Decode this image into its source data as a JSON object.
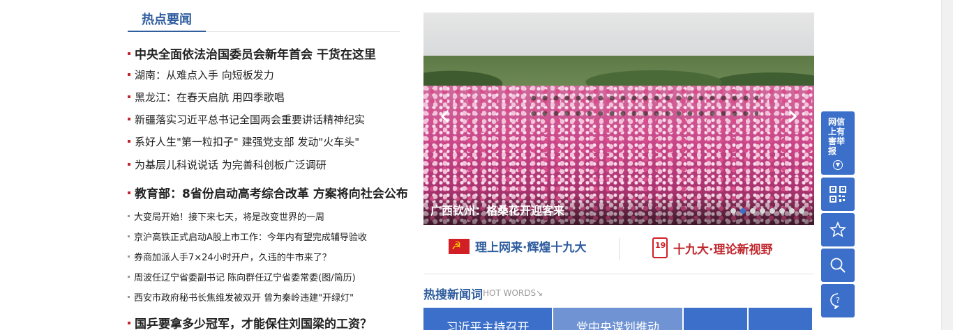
{
  "hot_news": {
    "title": "热点要闻",
    "items": [
      {
        "text": "中央全面依法治国委员会新年首会 干货在这里",
        "style": "big"
      },
      {
        "text": "湖南：从难点入手 向短板发力",
        "style": "normal"
      },
      {
        "text": "黑龙江：在春天启航 用四季歌唱",
        "style": "normal"
      },
      {
        "text": "新疆落实习近平总书记全国两会重要讲话精神纪实",
        "style": "normal"
      },
      {
        "text": "系好人生\"第一粒扣子\" 建强党支部 发动\"火车头\"",
        "style": "normal"
      },
      {
        "text": "为基层儿科说说话  为完善科创板广泛调研",
        "style": "normal"
      },
      {
        "text": "教育部：8省份启动高考综合改革 方案将向社会公布",
        "style": "big"
      },
      {
        "text": "大变局开始！接下来七天，将是改变世界的一周",
        "style": "small"
      },
      {
        "text": "京沪高铁正式启动A股上市工作：今年内有望完成辅导验收",
        "style": "small"
      },
      {
        "text": "券商加派人手7×24小时开户，久违的牛市来了？",
        "style": "small"
      },
      {
        "text": "周波任辽宁省委副书记 陈向群任辽宁省委常委(图/简历)",
        "style": "small"
      },
      {
        "text": "西安市政府秘书长焦维发被双开 曾为秦岭违建\"开绿灯\"",
        "style": "small"
      },
      {
        "text": "国乒要拿多少冠军，才能保住刘国梁的工资？",
        "style": "big"
      }
    ]
  },
  "carousel": {
    "caption": "广西钦州：格桑花开迎客来",
    "prev_icon": "chevron-left-icon",
    "next_icon": "chevron-right-icon",
    "active_slide": 2,
    "slide_count": 8
  },
  "banners": {
    "left": "理上网来·辉煌十九大",
    "right": "十九大·理论新视野",
    "left_icon": "party-flag-icon",
    "right_icon": "nineteen-calendar-icon"
  },
  "hot_words": {
    "title": "热搜新闻词",
    "subtitle": "HOT WORDS↘",
    "tiles": [
      "习近平主持召开",
      "党中央谋划推动",
      "",
      ""
    ]
  },
  "toolbar": {
    "report_label": "网信上有害举报",
    "icons": [
      "qr-code-icon",
      "star-icon",
      "search-icon",
      "help-icon"
    ]
  },
  "colors": {
    "brand_blue": "#3b6fc9",
    "title_blue": "#2f5d9e",
    "accent_red": "#c0272d"
  }
}
